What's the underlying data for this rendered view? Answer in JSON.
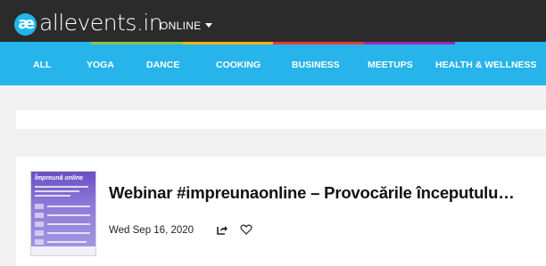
{
  "header": {
    "logo_mark": "æ",
    "logo_text": "allevents.in",
    "scope_label": "ONLINE"
  },
  "colors": {
    "topbar": "#2b2b2b",
    "nav": "#27b4ea",
    "strip": [
      "#1fb6ee",
      "#8bc34a",
      "#f4b400",
      "#e53935",
      "#9c27b0",
      "#1fb6ee"
    ]
  },
  "nav": {
    "items": [
      {
        "label": "ALL"
      },
      {
        "label": "YOGA"
      },
      {
        "label": "DANCE"
      },
      {
        "label": "COOKING"
      },
      {
        "label": "BUSINESS"
      },
      {
        "label": "MEETUPS"
      },
      {
        "label": "HEALTH & WELLNESS"
      }
    ]
  },
  "event": {
    "thumbnail_title": "Împreună online",
    "title": "Webinar #impreunaonline – Provocările începutulu…",
    "date": "Wed Sep 16, 2020",
    "share_icon": "share-icon",
    "favorite_icon": "heart-icon"
  }
}
